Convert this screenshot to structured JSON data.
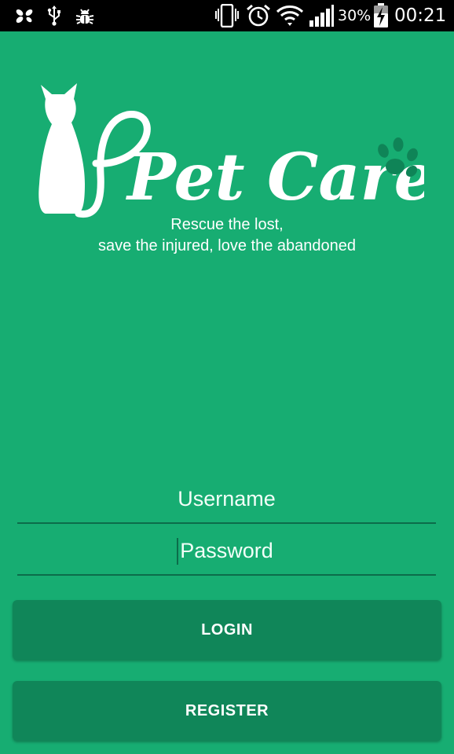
{
  "status_bar": {
    "left_icons": [
      "pinwheel-icon",
      "usb-icon",
      "bug-icon"
    ],
    "right_icons": [
      "vibrate-icon",
      "alarm-icon",
      "wifi-icon",
      "signal-icon",
      "battery-icon"
    ],
    "battery_percent": "30%",
    "time": "00:21"
  },
  "branding": {
    "logo_text": "Pet Care",
    "tagline_line1": "Rescue the lost,",
    "tagline_line2": "save the injured, love the abandoned"
  },
  "login_form": {
    "username_placeholder": "Username",
    "password_placeholder": "Password",
    "login_label": "LOGIN",
    "register_label": "REGISTER"
  },
  "colors": {
    "background": "#17ad72",
    "button": "#108659",
    "input_underline": "#0c6c4a",
    "paw_print": "#0f8457"
  }
}
